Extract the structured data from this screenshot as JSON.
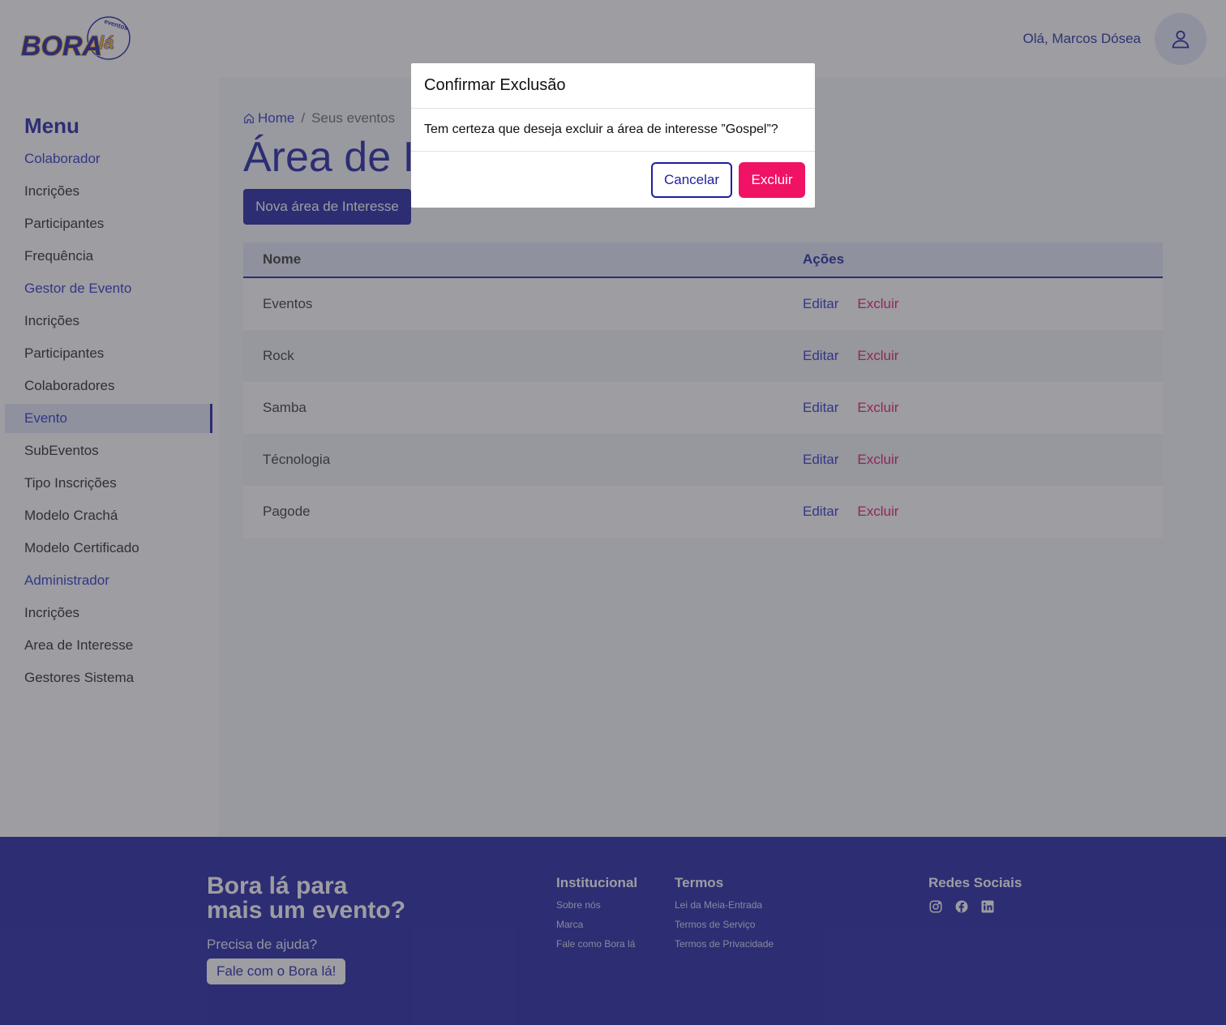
{
  "header": {
    "logo": {
      "main": "BORA",
      "accent": "lá",
      "tag": "eventos"
    },
    "greeting": "Olá, Marcos Dósea",
    "avatar_icon": "user-icon"
  },
  "sidebar": {
    "title": "Menu",
    "items": [
      {
        "label": "Colaborador",
        "type": "section"
      },
      {
        "label": "Incrições",
        "type": "item"
      },
      {
        "label": "Participantes",
        "type": "item"
      },
      {
        "label": "Frequência",
        "type": "item"
      },
      {
        "label": "Gestor de Evento",
        "type": "section"
      },
      {
        "label": "Incrições",
        "type": "item"
      },
      {
        "label": "Participantes",
        "type": "item"
      },
      {
        "label": "Colaboradores",
        "type": "item"
      },
      {
        "label": "Evento",
        "type": "active"
      },
      {
        "label": "SubEventos",
        "type": "item"
      },
      {
        "label": "Tipo Inscrições",
        "type": "item"
      },
      {
        "label": "Modelo Crachá",
        "type": "item"
      },
      {
        "label": "Modelo Certificado",
        "type": "item"
      },
      {
        "label": "Administrador",
        "type": "section"
      },
      {
        "label": "Incrições",
        "type": "item"
      },
      {
        "label": "Area de Interesse",
        "type": "item"
      },
      {
        "label": "Gestores Sistema",
        "type": "item"
      }
    ]
  },
  "main": {
    "breadcrumb": {
      "home": "Home",
      "separator": "/",
      "current": "Seus eventos"
    },
    "title": "Área de Interesse",
    "new_button": "Nova área de Interesse",
    "table": {
      "headers": {
        "name": "Nome",
        "actions": "Ações"
      },
      "edit_label": "Editar",
      "delete_label": "Excluir",
      "rows": [
        {
          "name": "Eventos"
        },
        {
          "name": "Rock"
        },
        {
          "name": "Samba"
        },
        {
          "name": "Técnologia"
        },
        {
          "name": "Pagode"
        }
      ]
    }
  },
  "footer": {
    "headline_1": "Bora lá para",
    "headline_2": "mais um evento?",
    "help": "Precisa de ajuda?",
    "help_button": "Fale com o Bora lá!",
    "institucional": {
      "title": "Institucional",
      "links": [
        "Sobre nós",
        "Marca",
        "Fale como Bora lá"
      ]
    },
    "termos": {
      "title": "Termos",
      "links": [
        "Lei da Meia-Entrada",
        "Termos de Serviço",
        "Termos de Privacidade"
      ]
    },
    "social": {
      "title": "Redes Sociais",
      "icons": [
        "instagram-icon",
        "facebook-icon",
        "linkedin-icon"
      ]
    }
  },
  "modal": {
    "title": "Confirmar Exclusão",
    "message": "Tem certeza que deseja excluir a área de interesse ”Gospel”?",
    "cancel": "Cancelar",
    "confirm": "Excluir"
  },
  "colors": {
    "primary": "#1d1fa0",
    "accent": "#2b30c7",
    "danger": "#ef1265",
    "logo_yellow": "#f5b223"
  }
}
